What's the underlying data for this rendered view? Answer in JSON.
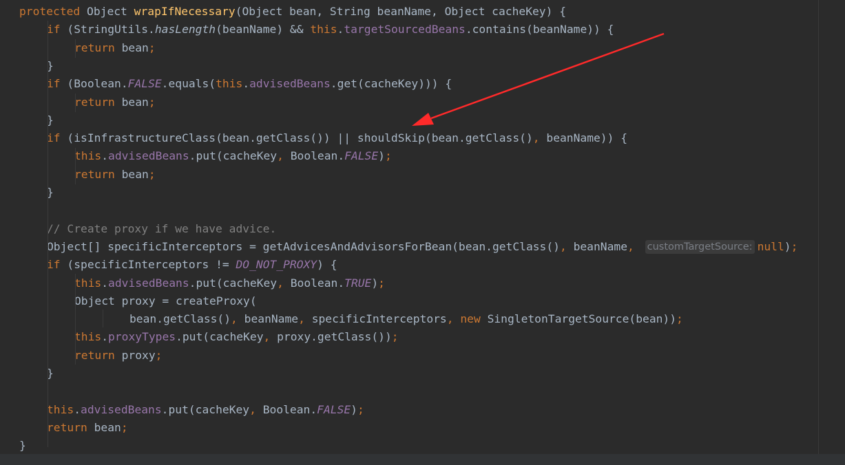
{
  "code": {
    "lines": [
      {
        "indent": 1,
        "tokens": [
          {
            "t": "protected ",
            "c": "kw"
          },
          {
            "t": "Object "
          },
          {
            "t": "wrapIfNecessary",
            "c": "fn"
          },
          {
            "t": "(Object bean, String beanName, Object cacheKey) {"
          }
        ]
      },
      {
        "indent": 2,
        "tokens": [
          {
            "t": "if ",
            "c": "kw"
          },
          {
            "t": "(StringUtils."
          },
          {
            "t": "hasLength",
            "c": "it"
          },
          {
            "t": "(beanName) && "
          },
          {
            "t": "this",
            "c": "kw"
          },
          {
            "t": "."
          },
          {
            "t": "targetSourcedBeans",
            "c": "fld"
          },
          {
            "t": ".contains(beanName)) {"
          }
        ]
      },
      {
        "indent": 3,
        "tokens": [
          {
            "t": "return ",
            "c": "kw"
          },
          {
            "t": "bean"
          },
          {
            "t": ";",
            "c": "kw"
          }
        ]
      },
      {
        "indent": 2,
        "tokens": [
          {
            "t": "}"
          }
        ]
      },
      {
        "indent": 2,
        "tokens": [
          {
            "t": "if ",
            "c": "kw"
          },
          {
            "t": "(Boolean."
          },
          {
            "t": "FALSE",
            "c": "fld it"
          },
          {
            "t": ".equals("
          },
          {
            "t": "this",
            "c": "kw"
          },
          {
            "t": "."
          },
          {
            "t": "advisedBeans",
            "c": "fld"
          },
          {
            "t": ".get(cacheKey))) {"
          }
        ]
      },
      {
        "indent": 3,
        "tokens": [
          {
            "t": "return ",
            "c": "kw"
          },
          {
            "t": "bean"
          },
          {
            "t": ";",
            "c": "kw"
          }
        ]
      },
      {
        "indent": 2,
        "tokens": [
          {
            "t": "}"
          }
        ]
      },
      {
        "indent": 2,
        "tokens": [
          {
            "t": "if ",
            "c": "kw"
          },
          {
            "t": "(isInfrastructureClass(bean.getClass()) || shouldSkip(bean.getClass()"
          },
          {
            "t": ", ",
            "c": "kw"
          },
          {
            "t": "beanName)) {"
          }
        ]
      },
      {
        "indent": 3,
        "tokens": [
          {
            "t": "this",
            "c": "kw"
          },
          {
            "t": "."
          },
          {
            "t": "advisedBeans",
            "c": "fld"
          },
          {
            "t": ".put(cacheKey"
          },
          {
            "t": ", ",
            "c": "kw"
          },
          {
            "t": "Boolean."
          },
          {
            "t": "FALSE",
            "c": "fld it"
          },
          {
            "t": ")"
          },
          {
            "t": ";",
            "c": "kw"
          }
        ]
      },
      {
        "indent": 3,
        "tokens": [
          {
            "t": "return ",
            "c": "kw"
          },
          {
            "t": "bean"
          },
          {
            "t": ";",
            "c": "kw"
          }
        ]
      },
      {
        "indent": 2,
        "tokens": [
          {
            "t": "}"
          }
        ]
      },
      {
        "indent": 0,
        "tokens": []
      },
      {
        "indent": 2,
        "tokens": [
          {
            "t": "// Create proxy if we have advice.",
            "c": "cmt"
          }
        ]
      },
      {
        "indent": 2,
        "tokens": [
          {
            "t": "Object[] specificInterceptors = getAdvicesAndAdvisorsForBean(bean.getClass()"
          },
          {
            "t": ", ",
            "c": "kw"
          },
          {
            "t": "beanName"
          },
          {
            "t": ", ",
            "c": "kw"
          },
          {
            "t": "customTargetSource:",
            "c": "hint"
          },
          {
            "t": "null",
            "c": "kw"
          },
          {
            "t": ")"
          },
          {
            "t": ";",
            "c": "kw"
          }
        ]
      },
      {
        "indent": 2,
        "tokens": [
          {
            "t": "if ",
            "c": "kw"
          },
          {
            "t": "(specificInterceptors != "
          },
          {
            "t": "DO_NOT_PROXY",
            "c": "fld it"
          },
          {
            "t": ") {"
          }
        ]
      },
      {
        "indent": 3,
        "tokens": [
          {
            "t": "this",
            "c": "kw"
          },
          {
            "t": "."
          },
          {
            "t": "advisedBeans",
            "c": "fld"
          },
          {
            "t": ".put(cacheKey"
          },
          {
            "t": ", ",
            "c": "kw"
          },
          {
            "t": "Boolean."
          },
          {
            "t": "TRUE",
            "c": "fld it"
          },
          {
            "t": ")"
          },
          {
            "t": ";",
            "c": "kw"
          }
        ]
      },
      {
        "indent": 3,
        "tokens": [
          {
            "t": "Object proxy = createProxy("
          }
        ]
      },
      {
        "indent": 5,
        "tokens": [
          {
            "t": "bean.getClass()"
          },
          {
            "t": ", ",
            "c": "kw"
          },
          {
            "t": "beanName"
          },
          {
            "t": ", ",
            "c": "kw"
          },
          {
            "t": "specificInterceptors"
          },
          {
            "t": ", ",
            "c": "kw"
          },
          {
            "t": "new ",
            "c": "kw"
          },
          {
            "t": "SingletonTargetSource(bean))"
          },
          {
            "t": ";",
            "c": "kw"
          }
        ]
      },
      {
        "indent": 3,
        "tokens": [
          {
            "t": "this",
            "c": "kw"
          },
          {
            "t": "."
          },
          {
            "t": "proxyTypes",
            "c": "fld"
          },
          {
            "t": ".put(cacheKey"
          },
          {
            "t": ", ",
            "c": "kw"
          },
          {
            "t": "proxy.getClass())"
          },
          {
            "t": ";",
            "c": "kw"
          }
        ]
      },
      {
        "indent": 3,
        "tokens": [
          {
            "t": "return ",
            "c": "kw"
          },
          {
            "t": "proxy"
          },
          {
            "t": ";",
            "c": "kw"
          }
        ]
      },
      {
        "indent": 2,
        "tokens": [
          {
            "t": "}"
          }
        ]
      },
      {
        "indent": 0,
        "tokens": []
      },
      {
        "indent": 2,
        "tokens": [
          {
            "t": "this",
            "c": "kw"
          },
          {
            "t": "."
          },
          {
            "t": "advisedBeans",
            "c": "fld"
          },
          {
            "t": ".put(cacheKey"
          },
          {
            "t": ", ",
            "c": "kw"
          },
          {
            "t": "Boolean."
          },
          {
            "t": "FALSE",
            "c": "fld it"
          },
          {
            "t": ")"
          },
          {
            "t": ";",
            "c": "kw"
          }
        ]
      },
      {
        "indent": 2,
        "tokens": [
          {
            "t": "return ",
            "c": "kw"
          },
          {
            "t": "bean"
          },
          {
            "t": ";",
            "c": "kw"
          }
        ]
      },
      {
        "indent": 1,
        "tokens": [
          {
            "t": "}"
          }
        ]
      }
    ]
  },
  "colors": {
    "background": "#2b2b2b",
    "text": "#a9b7c6",
    "keyword": "#cc7832",
    "method_declaration": "#ffc66d",
    "field": "#9876aa",
    "comment": "#808080",
    "annotation_arrow": "#ff2a2a"
  },
  "annotation": {
    "icon": "red-arrow-icon",
    "points_to": "shouldSkip"
  }
}
